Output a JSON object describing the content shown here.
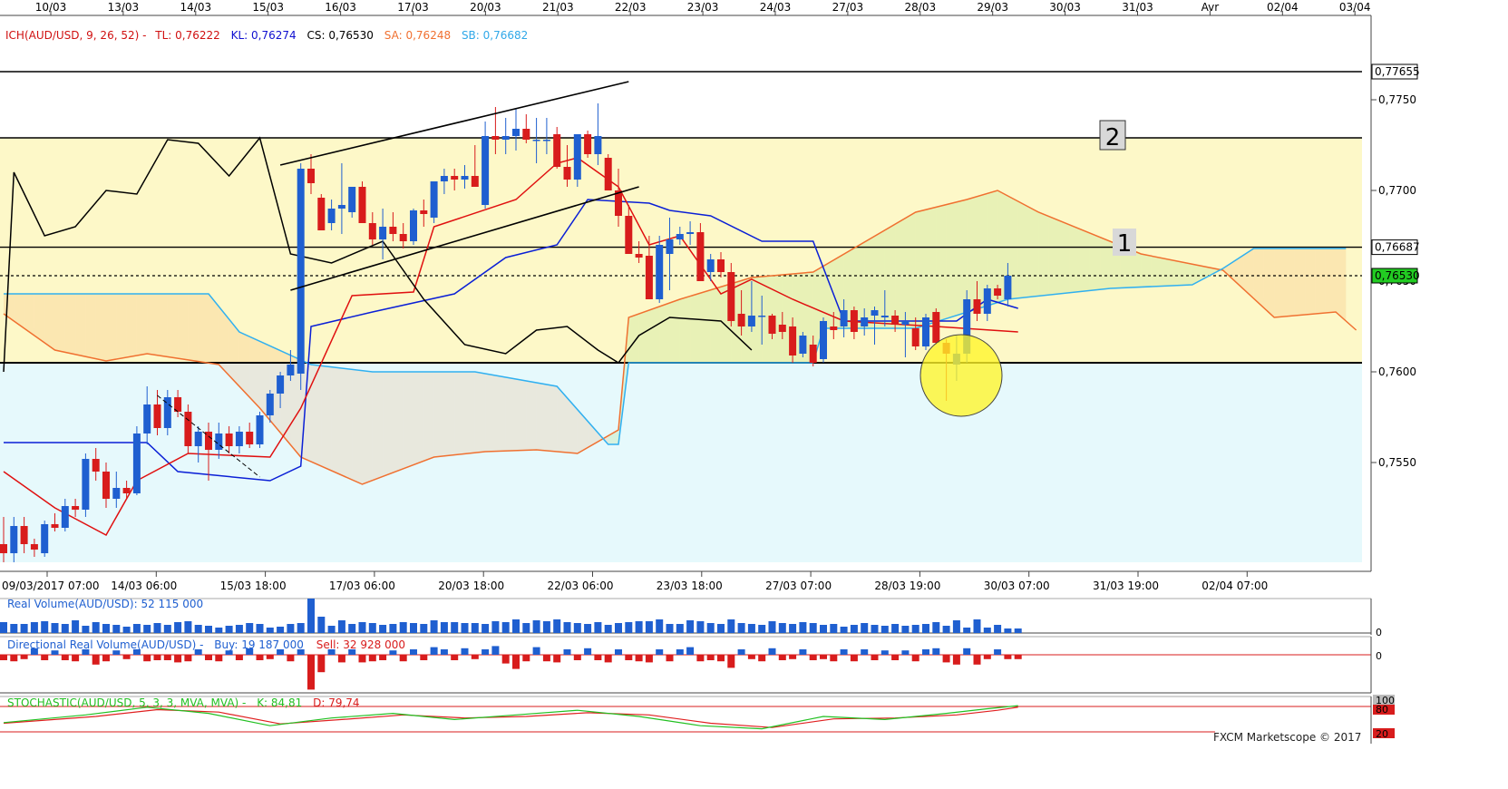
{
  "top_axis_dates": [
    "10/03",
    "13/03",
    "14/03",
    "15/03",
    "16/03",
    "17/03",
    "20/03",
    "21/03",
    "22/03",
    "23/03",
    "24/03",
    "27/03",
    "28/03",
    "29/03",
    "30/03",
    "31/03",
    "Avr",
    "02/04",
    "03/04"
  ],
  "bottom_axis_labels": [
    "09/03/2017 07:00",
    "14/03 06:00",
    "15/03 18:00",
    "17/03 06:00",
    "20/03 18:00",
    "22/03 06:00",
    "23/03 18:00",
    "27/03 07:00",
    "28/03 19:00",
    "30/03 07:00",
    "31/03 19:00",
    "02/04 07:00"
  ],
  "ichimoku_legend": {
    "name": "ICH(AUD/USD, 9, 26, 52) -",
    "tl": "TL: 0,76222",
    "kl": "KL: 0,76274",
    "cs": "CS: 0,76530",
    "sa": "SA: 0,76248",
    "sb": "SB: 0,76682"
  },
  "y_axis_ticks": [
    "0,7750",
    "0,7700",
    "0,7650",
    "0,7600",
    "0,7550"
  ],
  "price_tags": {
    "top_level": "0,77655",
    "level1": "0,76687",
    "current": "0,76530"
  },
  "zone_labels": {
    "zone1": "1",
    "zone2": "2"
  },
  "volume_panel": {
    "title": "Real Volume(AUD/USD): 52 115 000",
    "zero": "0"
  },
  "directional_panel": {
    "title": "Directional Real Volume(AUD/USD) -",
    "buy": "Buy: 19 187 000",
    "sell": "Sell: 32 928 000",
    "zero": "0"
  },
  "stochastic_panel": {
    "title": "STOCHASTIC(AUD/USD, 5, 3, 3, MVA, MVA) -",
    "k": "K: 84,81",
    "d": "D: 79,74",
    "levels": [
      "100",
      "80",
      "20"
    ]
  },
  "watermark": "FXCM Marketscope © 2017",
  "colors": {
    "bull": "#1f5fd0",
    "bear": "#d81c1c",
    "tenkan": "#e01010",
    "kijun": "#0a1fd6",
    "chikou": "#000000",
    "senkou_a": "#f07030",
    "senkou_b": "#30b0f0",
    "zone_fill": "#fdf8c8",
    "lower_fill": "#e6f9fc",
    "stoch_k": "#22c022",
    "stoch_d": "#e02020"
  },
  "chart_data": {
    "type": "candlestick",
    "symbol": "AUD/USD",
    "ylim": [
      0.7495,
      0.7795
    ],
    "horizontal_levels": [
      0.77655,
      0.7729,
      0.76687,
      0.7653,
      0.7605
    ],
    "candles": [
      [
        0.7505,
        0.752,
        0.7495,
        0.75
      ],
      [
        0.75,
        0.752,
        0.7495,
        0.7515
      ],
      [
        0.7515,
        0.752,
        0.75,
        0.7505
      ],
      [
        0.7505,
        0.7508,
        0.7498,
        0.7502
      ],
      [
        0.75,
        0.7518,
        0.7498,
        0.7516
      ],
      [
        0.7516,
        0.7522,
        0.7512,
        0.7514
      ],
      [
        0.7514,
        0.753,
        0.7512,
        0.7526
      ],
      [
        0.7526,
        0.753,
        0.752,
        0.7524
      ],
      [
        0.7524,
        0.7555,
        0.752,
        0.7552
      ],
      [
        0.7552,
        0.7558,
        0.754,
        0.7545
      ],
      [
        0.7545,
        0.755,
        0.7525,
        0.753
      ],
      [
        0.753,
        0.7545,
        0.7525,
        0.7536
      ],
      [
        0.7536,
        0.754,
        0.753,
        0.7533
      ],
      [
        0.7533,
        0.757,
        0.7532,
        0.7566
      ],
      [
        0.7566,
        0.7592,
        0.756,
        0.7582
      ],
      [
        0.7582,
        0.759,
        0.7565,
        0.7569
      ],
      [
        0.7569,
        0.759,
        0.7565,
        0.7586
      ],
      [
        0.7586,
        0.759,
        0.7575,
        0.7578
      ],
      [
        0.7578,
        0.7582,
        0.7555,
        0.7559
      ],
      [
        0.7559,
        0.757,
        0.755,
        0.7567
      ],
      [
        0.7567,
        0.7572,
        0.754,
        0.7557
      ],
      [
        0.7557,
        0.7572,
        0.7552,
        0.7566
      ],
      [
        0.7566,
        0.757,
        0.7555,
        0.7559
      ],
      [
        0.7559,
        0.757,
        0.7555,
        0.7567
      ],
      [
        0.7567,
        0.7572,
        0.7558,
        0.756
      ],
      [
        0.756,
        0.7578,
        0.7558,
        0.7576
      ],
      [
        0.7576,
        0.759,
        0.7572,
        0.7588
      ],
      [
        0.7588,
        0.76,
        0.758,
        0.7598
      ],
      [
        0.7598,
        0.7612,
        0.7595,
        0.7604
      ],
      [
        0.7599,
        0.7715,
        0.759,
        0.7712
      ],
      [
        0.7712,
        0.772,
        0.7698,
        0.7704
      ],
      [
        0.7696,
        0.7698,
        0.7678,
        0.7678
      ],
      [
        0.7682,
        0.7695,
        0.7678,
        0.769
      ],
      [
        0.769,
        0.7715,
        0.7676,
        0.7692
      ],
      [
        0.7688,
        0.7702,
        0.7685,
        0.7702
      ],
      [
        0.7702,
        0.7705,
        0.7682,
        0.7682
      ],
      [
        0.7682,
        0.7688,
        0.767,
        0.7673
      ],
      [
        0.7673,
        0.769,
        0.7662,
        0.768
      ],
      [
        0.768,
        0.7688,
        0.7672,
        0.7676
      ],
      [
        0.7676,
        0.7682,
        0.7668,
        0.7672
      ],
      [
        0.7672,
        0.769,
        0.767,
        0.7689
      ],
      [
        0.7689,
        0.7695,
        0.768,
        0.7687
      ],
      [
        0.7685,
        0.7705,
        0.7682,
        0.7705
      ],
      [
        0.7705,
        0.7712,
        0.7698,
        0.7708
      ],
      [
        0.7708,
        0.7712,
        0.77,
        0.7706
      ],
      [
        0.7706,
        0.7714,
        0.7701,
        0.7708
      ],
      [
        0.7708,
        0.7725,
        0.7702,
        0.7702
      ],
      [
        0.7692,
        0.7738,
        0.769,
        0.773
      ],
      [
        0.773,
        0.7746,
        0.772,
        0.7728
      ],
      [
        0.7728,
        0.774,
        0.772,
        0.773
      ],
      [
        0.773,
        0.7745,
        0.7722,
        0.7734
      ],
      [
        0.7734,
        0.7742,
        0.7726,
        0.7728
      ],
      [
        0.7728,
        0.774,
        0.7715,
        0.7728
      ],
      [
        0.7728,
        0.774,
        0.772,
        0.7728
      ],
      [
        0.7731,
        0.7735,
        0.7712,
        0.7713
      ],
      [
        0.7713,
        0.7725,
        0.7702,
        0.7706
      ],
      [
        0.7706,
        0.773,
        0.7702,
        0.7731
      ],
      [
        0.7731,
        0.7733,
        0.7718,
        0.772
      ],
      [
        0.772,
        0.7748,
        0.7714,
        0.773
      ],
      [
        0.7718,
        0.772,
        0.77,
        0.77
      ],
      [
        0.77,
        0.7712,
        0.768,
        0.7686
      ],
      [
        0.7686,
        0.7692,
        0.7665,
        0.7665
      ],
      [
        0.7665,
        0.7672,
        0.766,
        0.7663
      ],
      [
        0.7664,
        0.7675,
        0.764,
        0.764
      ],
      [
        0.764,
        0.7675,
        0.7638,
        0.767
      ],
      [
        0.7665,
        0.7685,
        0.7645,
        0.7673
      ],
      [
        0.7673,
        0.768,
        0.767,
        0.7676
      ],
      [
        0.7676,
        0.7683,
        0.767,
        0.7677
      ],
      [
        0.7677,
        0.7682,
        0.765,
        0.765
      ],
      [
        0.7655,
        0.7665,
        0.765,
        0.7662
      ],
      [
        0.7662,
        0.7666,
        0.7652,
        0.7655
      ],
      [
        0.7655,
        0.766,
        0.7625,
        0.7628
      ],
      [
        0.7632,
        0.7645,
        0.762,
        0.7625
      ],
      [
        0.7625,
        0.765,
        0.7622,
        0.7631
      ],
      [
        0.7631,
        0.7642,
        0.7615,
        0.7631
      ],
      [
        0.7631,
        0.7632,
        0.7618,
        0.7621
      ],
      [
        0.7626,
        0.7633,
        0.7618,
        0.7622
      ],
      [
        0.7625,
        0.763,
        0.7605,
        0.7609
      ],
      [
        0.761,
        0.7622,
        0.7608,
        0.762
      ],
      [
        0.7615,
        0.762,
        0.7603,
        0.7605
      ],
      [
        0.7607,
        0.763,
        0.7605,
        0.7628
      ],
      [
        0.7625,
        0.7633,
        0.7618,
        0.7623
      ],
      [
        0.7625,
        0.764,
        0.7619,
        0.7634
      ],
      [
        0.7634,
        0.7636,
        0.7618,
        0.7622
      ],
      [
        0.7625,
        0.7635,
        0.762,
        0.763
      ],
      [
        0.7631,
        0.7636,
        0.7615,
        0.7634
      ],
      [
        0.763,
        0.7645,
        0.7625,
        0.7631
      ],
      [
        0.7631,
        0.7634,
        0.7622,
        0.7626
      ],
      [
        0.7626,
        0.7633,
        0.7608,
        0.7628
      ],
      [
        0.7624,
        0.763,
        0.7612,
        0.7614
      ],
      [
        0.7614,
        0.7632,
        0.7612,
        0.763
      ],
      [
        0.7633,
        0.7635,
        0.7615,
        0.7616
      ],
      [
        0.7616,
        0.7618,
        0.7584,
        0.761
      ],
      [
        0.7604,
        0.762,
        0.7595,
        0.761
      ],
      [
        0.761,
        0.7645,
        0.7605,
        0.764
      ],
      [
        0.764,
        0.765,
        0.7628,
        0.7632
      ],
      [
        0.7632,
        0.7648,
        0.7628,
        0.7646
      ],
      [
        0.7646,
        0.7648,
        0.764,
        0.7642
      ],
      [
        0.764,
        0.766,
        0.7636,
        0.7653
      ]
    ],
    "tenkan": [
      [
        0,
        0.7545
      ],
      [
        5,
        0.7525
      ],
      [
        10,
        0.751
      ],
      [
        13,
        0.754
      ],
      [
        18,
        0.7555
      ],
      [
        26,
        0.7553
      ],
      [
        29,
        0.758
      ],
      [
        34,
        0.7642
      ],
      [
        40,
        0.7644
      ],
      [
        42,
        0.768
      ],
      [
        50,
        0.7695
      ],
      [
        54,
        0.7715
      ],
      [
        56,
        0.7718
      ],
      [
        60,
        0.7702
      ],
      [
        63,
        0.767
      ],
      [
        66,
        0.7675
      ],
      [
        70,
        0.7643
      ],
      [
        73,
        0.7651
      ],
      [
        77,
        0.764
      ],
      [
        82,
        0.7628
      ],
      [
        91,
        0.7625
      ],
      [
        99,
        0.7622
      ]
    ],
    "kijun": [
      [
        0,
        0.7561
      ],
      [
        14,
        0.7561
      ],
      [
        17,
        0.7545
      ],
      [
        26,
        0.754
      ],
      [
        29,
        0.7548
      ],
      [
        30,
        0.7625
      ],
      [
        36,
        0.7633
      ],
      [
        44,
        0.7643
      ],
      [
        49,
        0.7663
      ],
      [
        54,
        0.767
      ],
      [
        57,
        0.7695
      ],
      [
        63,
        0.7693
      ],
      [
        65,
        0.7689
      ],
      [
        69,
        0.7686
      ],
      [
        74,
        0.7672
      ],
      [
        79,
        0.7672
      ],
      [
        82,
        0.7628
      ],
      [
        93,
        0.7628
      ],
      [
        96,
        0.764
      ],
      [
        99,
        0.7635
      ]
    ],
    "chikou": [
      [
        0,
        0.76
      ],
      [
        1,
        0.771
      ],
      [
        4,
        0.7675
      ],
      [
        7,
        0.768
      ],
      [
        10,
        0.77
      ],
      [
        13,
        0.7698
      ],
      [
        16,
        0.7728
      ],
      [
        19,
        0.7726
      ],
      [
        22,
        0.7708
      ],
      [
        25,
        0.7729
      ],
      [
        28,
        0.7665
      ],
      [
        32,
        0.766
      ],
      [
        37,
        0.7672
      ],
      [
        41,
        0.764
      ],
      [
        45,
        0.7615
      ],
      [
        49,
        0.761
      ],
      [
        52,
        0.7623
      ],
      [
        55,
        0.7625
      ],
      [
        58,
        0.7612
      ],
      [
        60,
        0.7605
      ],
      [
        62,
        0.762
      ],
      [
        65,
        0.763
      ],
      [
        70,
        0.7628
      ],
      [
        73,
        0.7612
      ]
    ],
    "senkou_a": [
      [
        0,
        0.7632
      ],
      [
        5,
        0.7612
      ],
      [
        10,
        0.7606
      ],
      [
        14,
        0.761
      ],
      [
        21,
        0.7604
      ],
      [
        25,
        0.758
      ],
      [
        29,
        0.7553
      ],
      [
        35,
        0.7538
      ],
      [
        42,
        0.7553
      ],
      [
        47,
        0.7556
      ],
      [
        52,
        0.7557
      ],
      [
        56,
        0.7555
      ],
      [
        60,
        0.7568
      ],
      [
        61,
        0.763
      ],
      [
        66,
        0.764
      ],
      [
        73,
        0.7652
      ],
      [
        79,
        0.7655
      ],
      [
        89,
        0.7688
      ],
      [
        94,
        0.7695
      ],
      [
        97,
        0.77
      ],
      [
        101,
        0.7688
      ],
      [
        111,
        0.7665
      ],
      [
        119,
        0.7656
      ],
      [
        124,
        0.763
      ],
      [
        130,
        0.7633
      ],
      [
        132,
        0.7623
      ]
    ],
    "senkou_b": [
      [
        0,
        0.7643
      ],
      [
        20,
        0.7643
      ],
      [
        23,
        0.7622
      ],
      [
        30,
        0.7604
      ],
      [
        36,
        0.76
      ],
      [
        46,
        0.76
      ],
      [
        54,
        0.7592
      ],
      [
        59,
        0.756
      ],
      [
        60,
        0.756
      ],
      [
        61,
        0.7605
      ],
      [
        79,
        0.7605
      ],
      [
        80,
        0.7624
      ],
      [
        89,
        0.7624
      ],
      [
        98,
        0.764
      ],
      [
        108,
        0.7646
      ],
      [
        116,
        0.7648
      ],
      [
        119,
        0.7657
      ],
      [
        122,
        0.7668
      ],
      [
        131,
        0.7668
      ]
    ],
    "trend_lines": [
      {
        "from": [
          27,
          0.7714
        ],
        "to": [
          61,
          0.776
        ]
      },
      {
        "from": [
          28,
          0.7645
        ],
        "to": [
          62,
          0.7702
        ]
      },
      {
        "from": [
          15,
          0.7587
        ],
        "to": [
          25,
          0.7542
        ]
      }
    ],
    "volume": [
      12,
      10,
      10,
      12,
      13,
      11,
      10,
      14,
      8,
      12,
      10,
      9,
      7,
      10,
      9,
      11,
      9,
      12,
      13,
      9,
      8,
      6,
      8,
      9,
      11,
      10,
      6,
      7,
      10,
      11,
      38,
      18,
      8,
      14,
      10,
      12,
      11,
      9,
      10,
      12,
      11,
      10,
      14,
      12,
      12,
      11,
      11,
      10,
      13,
      12,
      15,
      11,
      14,
      13,
      15,
      12,
      11,
      10,
      12,
      9,
      11,
      12,
      13,
      13,
      15,
      10,
      10,
      14,
      13,
      11,
      10,
      15,
      11,
      10,
      9,
      13,
      11,
      10,
      12,
      11,
      9,
      10,
      7,
      9,
      11,
      9,
      8,
      10,
      8,
      9,
      10,
      12,
      8,
      14,
      6,
      15,
      6,
      9,
      5,
      5
    ],
    "directional": [
      -5,
      -6,
      -4,
      6,
      -5,
      4,
      -5,
      -6,
      5,
      -9,
      -6,
      4,
      -4,
      5,
      -6,
      -5,
      -5,
      -7,
      -6,
      5,
      -5,
      -6,
      4,
      -5,
      6,
      -5,
      -4,
      5,
      -6,
      5,
      -32,
      -16,
      5,
      -7,
      5,
      -7,
      -6,
      -5,
      4,
      -6,
      5,
      -5,
      7,
      5,
      -5,
      6,
      -4,
      5,
      8,
      -8,
      -13,
      -6,
      7,
      -6,
      -7,
      5,
      -5,
      6,
      -5,
      -7,
      5,
      -5,
      -6,
      -7,
      5,
      -6,
      5,
      7,
      -6,
      -5,
      -6,
      -12,
      5,
      -4,
      -6,
      6,
      -5,
      -4,
      5,
      -5,
      -4,
      -6,
      5,
      -6,
      5,
      -5,
      4,
      -5,
      4,
      -6,
      5,
      6,
      -7,
      -9,
      6,
      -9,
      -4,
      5,
      -4,
      -4
    ],
    "stoch_k": [
      [
        0,
        30
      ],
      [
        8,
        55
      ],
      [
        14,
        80
      ],
      [
        20,
        60
      ],
      [
        26,
        20
      ],
      [
        32,
        45
      ],
      [
        38,
        60
      ],
      [
        44,
        40
      ],
      [
        50,
        55
      ],
      [
        56,
        70
      ],
      [
        62,
        50
      ],
      [
        68,
        20
      ],
      [
        74,
        10
      ],
      [
        80,
        50
      ],
      [
        86,
        40
      ],
      [
        92,
        60
      ],
      [
        96,
        75
      ],
      [
        99,
        85
      ]
    ],
    "stoch_d": [
      [
        0,
        28
      ],
      [
        9,
        50
      ],
      [
        15,
        72
      ],
      [
        21,
        64
      ],
      [
        27,
        26
      ],
      [
        33,
        40
      ],
      [
        39,
        55
      ],
      [
        45,
        45
      ],
      [
        51,
        50
      ],
      [
        57,
        62
      ],
      [
        63,
        55
      ],
      [
        69,
        28
      ],
      [
        75,
        14
      ],
      [
        81,
        42
      ],
      [
        87,
        45
      ],
      [
        93,
        55
      ],
      [
        97,
        70
      ],
      [
        99,
        80
      ]
    ]
  }
}
